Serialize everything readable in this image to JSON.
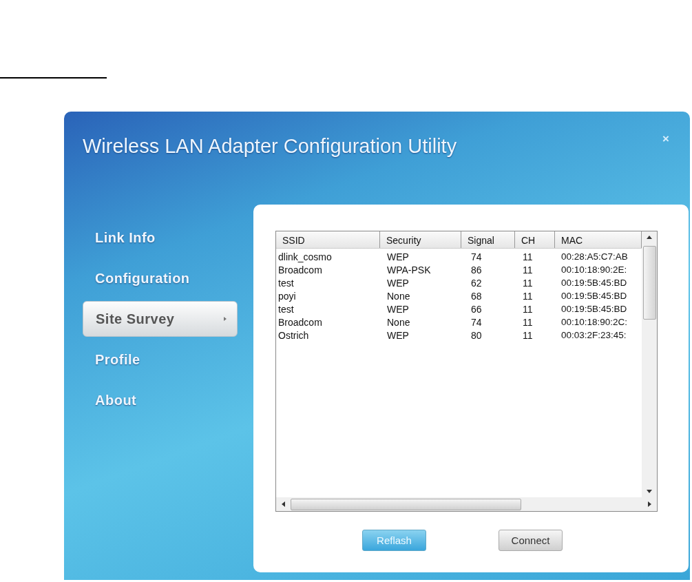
{
  "window": {
    "title": "Wireless LAN Adapter Configuration Utility",
    "close": "×"
  },
  "sidebar": {
    "items": [
      {
        "label": "Link Info",
        "selected": false
      },
      {
        "label": "Configuration",
        "selected": false
      },
      {
        "label": "Site Survey",
        "selected": true
      },
      {
        "label": "Profile",
        "selected": false
      },
      {
        "label": "About",
        "selected": false
      }
    ]
  },
  "table": {
    "columns": [
      "SSID",
      "Security",
      "Signal",
      "CH",
      "MAC"
    ],
    "rows": [
      [
        "dlink_cosmo",
        "WEP",
        "74",
        "11",
        "00:28:A5:C7:AB"
      ],
      [
        "Broadcom",
        "WPA-PSK",
        "86",
        "11",
        "00:10:18:90:2E:"
      ],
      [
        "test",
        "WEP",
        "62",
        "11",
        "00:19:5B:45:BD"
      ],
      [
        "poyi",
        "None",
        "68",
        "11",
        "00:19:5B:45:BD"
      ],
      [
        "test",
        "WEP",
        "66",
        "11",
        "00:19:5B:45:BD"
      ],
      [
        "Broadcom",
        "None",
        "74",
        "11",
        "00:10:18:90:2C:"
      ],
      [
        "Ostrich",
        "WEP",
        "80",
        "11",
        "00:03:2F:23:45:"
      ]
    ]
  },
  "buttons": [
    {
      "label": "Reflash",
      "kind": "primary"
    },
    {
      "label": "Connect",
      "kind": "normal"
    }
  ]
}
